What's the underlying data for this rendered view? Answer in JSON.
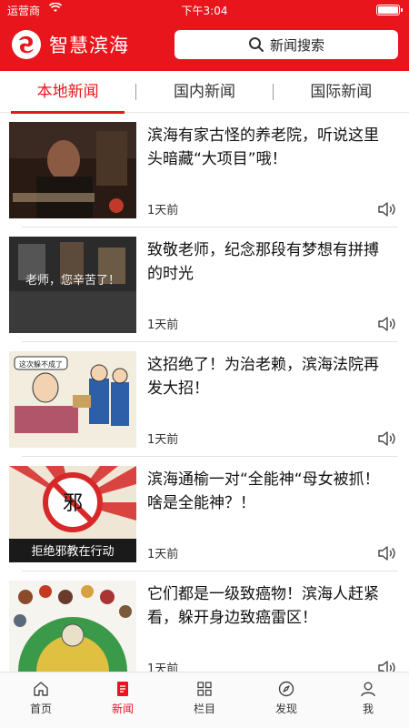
{
  "status_bar": {
    "carrier": "运营商",
    "time": "下午3:04"
  },
  "header": {
    "app_name": "智慧滨海",
    "search_label": "新闻搜索"
  },
  "tabs": [
    {
      "label": "本地新闻",
      "active": true
    },
    {
      "label": "国内新闻",
      "active": false
    },
    {
      "label": "国际新闻",
      "active": false
    }
  ],
  "news": [
    {
      "title": "滨海有家古怪的养老院，听说这里头暗藏“大项目”哦！",
      "time": "1天前",
      "thumb_text": ""
    },
    {
      "title": "致敬老师，纪念那段有梦想有拼搏的时光",
      "time": "1天前",
      "thumb_text": "老师，您辛苦了！"
    },
    {
      "title": "这招绝了！为治老赖，滨海法院再发大招！",
      "time": "1天前",
      "thumb_text": "这次躲不成了"
    },
    {
      "title": "滨海通榆一对“全能神“母女被抓！啥是全能神？！",
      "time": "1天前",
      "thumb_text": "拒绝邪教在行动"
    },
    {
      "title": "它们都是一级致癌物！滨海人赶紧看，躲开身边致癌雷区！",
      "time": "1天前",
      "thumb_text": ""
    }
  ],
  "bottom_nav": [
    {
      "label": "首页",
      "icon": "home-icon",
      "active": false
    },
    {
      "label": "新闻",
      "icon": "news-icon",
      "active": true
    },
    {
      "label": "栏目",
      "icon": "grid-icon",
      "active": false
    },
    {
      "label": "发现",
      "icon": "compass-icon",
      "active": false
    },
    {
      "label": "我",
      "icon": "profile-icon",
      "active": false
    }
  ],
  "colors": {
    "brand_red": "#e8161c"
  }
}
